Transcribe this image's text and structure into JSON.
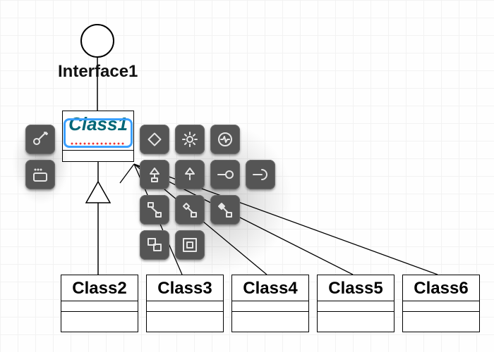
{
  "diagram": {
    "interface": {
      "label": "Interface1"
    },
    "classes": [
      {
        "name": "Class1",
        "selected": true
      },
      {
        "name": "Class2"
      },
      {
        "name": "Class3"
      },
      {
        "name": "Class4"
      },
      {
        "name": "Class5"
      },
      {
        "name": "Class6"
      }
    ]
  },
  "popup_tools": {
    "left": [
      "add-attribute",
      "add-operation"
    ],
    "right_row1": [
      "note",
      "settings",
      "quick-edit"
    ],
    "right_row2": [
      "generalization",
      "realization",
      "provided-interface",
      "required-interface"
    ],
    "right_row3": [
      "association",
      "aggregation",
      "composition"
    ],
    "right_row4": [
      "containment",
      "nesting"
    ]
  },
  "colors": {
    "button_bg": "#555555",
    "selection": "#3aa0ff",
    "spellcheck": "#e33"
  }
}
